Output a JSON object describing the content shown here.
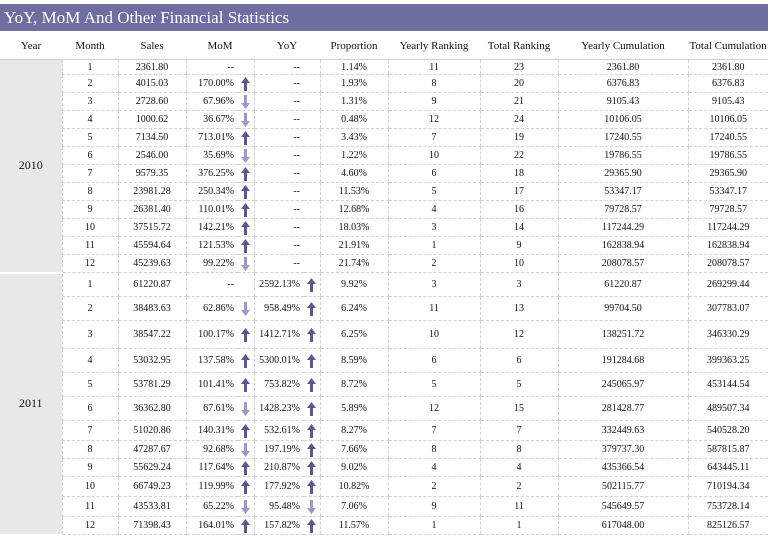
{
  "title": "YoY, MoM And Other Financial Statistics",
  "headers": [
    "Year",
    "Month",
    "Sales",
    "MoM",
    "YoY",
    "Proportion",
    "Yearly Ranking",
    "Total Ranking",
    "Yearly Cumulation",
    "Total Cumulation"
  ],
  "colors": {
    "title_bg": "#6e6fa0",
    "arrow_up": "#5a5a8a",
    "arrow_down": "#9a9ac8",
    "year_bg": "#e8e8e8"
  },
  "groups": [
    {
      "year": "2010",
      "rows": [
        {
          "month": "1",
          "sales": "2361.80",
          "mom": "--",
          "mom_dir": "",
          "yoy": "--",
          "yoy_dir": "",
          "prop": "1.14%",
          "yr": "11",
          "tr": "23",
          "ycum": "2361.80",
          "tcum": "2361.80"
        },
        {
          "month": "2",
          "sales": "4015.03",
          "mom": "170.00%",
          "mom_dir": "up",
          "yoy": "--",
          "yoy_dir": "",
          "prop": "1.93%",
          "yr": "8",
          "tr": "20",
          "ycum": "6376.83",
          "tcum": "6376.83"
        },
        {
          "month": "3",
          "sales": "2728.60",
          "mom": "67.96%",
          "mom_dir": "down",
          "yoy": "--",
          "yoy_dir": "",
          "prop": "1.31%",
          "yr": "9",
          "tr": "21",
          "ycum": "9105.43",
          "tcum": "9105.43"
        },
        {
          "month": "4",
          "sales": "1000.62",
          "mom": "36.67%",
          "mom_dir": "down",
          "yoy": "--",
          "yoy_dir": "",
          "prop": "0.48%",
          "yr": "12",
          "tr": "24",
          "ycum": "10106.05",
          "tcum": "10106.05"
        },
        {
          "month": "5",
          "sales": "7134.50",
          "mom": "713.01%",
          "mom_dir": "up",
          "yoy": "--",
          "yoy_dir": "",
          "prop": "3.43%",
          "yr": "7",
          "tr": "19",
          "ycum": "17240.55",
          "tcum": "17240.55"
        },
        {
          "month": "6",
          "sales": "2546.00",
          "mom": "35.69%",
          "mom_dir": "down",
          "yoy": "--",
          "yoy_dir": "",
          "prop": "1.22%",
          "yr": "10",
          "tr": "22",
          "ycum": "19786.55",
          "tcum": "19786.55"
        },
        {
          "month": "7",
          "sales": "9579.35",
          "mom": "376.25%",
          "mom_dir": "up",
          "yoy": "--",
          "yoy_dir": "",
          "prop": "4.60%",
          "yr": "6",
          "tr": "18",
          "ycum": "29365.90",
          "tcum": "29365.90"
        },
        {
          "month": "8",
          "sales": "23981.28",
          "mom": "250.34%",
          "mom_dir": "up",
          "yoy": "--",
          "yoy_dir": "",
          "prop": "11.53%",
          "yr": "5",
          "tr": "17",
          "ycum": "53347.17",
          "tcum": "53347.17"
        },
        {
          "month": "9",
          "sales": "26381.40",
          "mom": "110.01%",
          "mom_dir": "up",
          "yoy": "--",
          "yoy_dir": "",
          "prop": "12.68%",
          "yr": "4",
          "tr": "16",
          "ycum": "79728.57",
          "tcum": "79728.57"
        },
        {
          "month": "10",
          "sales": "37515.72",
          "mom": "142.21%",
          "mom_dir": "up",
          "yoy": "--",
          "yoy_dir": "",
          "prop": "18.03%",
          "yr": "3",
          "tr": "14",
          "ycum": "117244.29",
          "tcum": "117244.29"
        },
        {
          "month": "11",
          "sales": "45594.64",
          "mom": "121.53%",
          "mom_dir": "up",
          "yoy": "--",
          "yoy_dir": "",
          "prop": "21.91%",
          "yr": "1",
          "tr": "9",
          "ycum": "162838.94",
          "tcum": "162838.94"
        },
        {
          "month": "12",
          "sales": "45239.63",
          "mom": "99.22%",
          "mom_dir": "down",
          "yoy": "--",
          "yoy_dir": "",
          "prop": "21.74%",
          "yr": "2",
          "tr": "10",
          "ycum": "208078.57",
          "tcum": "208078.57"
        }
      ]
    },
    {
      "year": "2011",
      "rows": [
        {
          "month": "1",
          "sales": "61220.87",
          "mom": "--",
          "mom_dir": "",
          "yoy": "2592.13%",
          "yoy_dir": "up",
          "prop": "9.92%",
          "yr": "3",
          "tr": "3",
          "ycum": "61220.87",
          "tcum": "269299.44"
        },
        {
          "month": "2",
          "sales": "38483.63",
          "mom": "62.86%",
          "mom_dir": "down",
          "yoy": "958.49%",
          "yoy_dir": "up",
          "prop": "6.24%",
          "yr": "11",
          "tr": "13",
          "ycum": "99704.50",
          "tcum": "307783.07"
        },
        {
          "month": "3",
          "sales": "38547.22",
          "mom": "100.17%",
          "mom_dir": "up",
          "yoy": "1412.71%",
          "yoy_dir": "up",
          "prop": "6.25%",
          "yr": "10",
          "tr": "12",
          "ycum": "138251.72",
          "tcum": "346330.29"
        },
        {
          "month": "4",
          "sales": "53032.95",
          "mom": "137.58%",
          "mom_dir": "up",
          "yoy": "5300.01%",
          "yoy_dir": "up",
          "prop": "8.59%",
          "yr": "6",
          "tr": "6",
          "ycum": "191284.68",
          "tcum": "399363.25"
        },
        {
          "month": "5",
          "sales": "53781.29",
          "mom": "101.41%",
          "mom_dir": "up",
          "yoy": "753.82%",
          "yoy_dir": "up",
          "prop": "8.72%",
          "yr": "5",
          "tr": "5",
          "ycum": "245065.97",
          "tcum": "453144.54"
        },
        {
          "month": "6",
          "sales": "36362.80",
          "mom": "67.61%",
          "mom_dir": "down",
          "yoy": "1428.23%",
          "yoy_dir": "up",
          "prop": "5.89%",
          "yr": "12",
          "tr": "15",
          "ycum": "281428.77",
          "tcum": "489507.34"
        },
        {
          "month": "7",
          "sales": "51020.86",
          "mom": "140.31%",
          "mom_dir": "up",
          "yoy": "532.61%",
          "yoy_dir": "up",
          "prop": "8.27%",
          "yr": "7",
          "tr": "7",
          "ycum": "332449.63",
          "tcum": "540528.20"
        },
        {
          "month": "8",
          "sales": "47287.67",
          "mom": "92.68%",
          "mom_dir": "down",
          "yoy": "197.19%",
          "yoy_dir": "up",
          "prop": "7.66%",
          "yr": "8",
          "tr": "8",
          "ycum": "379737.30",
          "tcum": "587815.87"
        },
        {
          "month": "9",
          "sales": "55629.24",
          "mom": "117.64%",
          "mom_dir": "up",
          "yoy": "210.87%",
          "yoy_dir": "up",
          "prop": "9.02%",
          "yr": "4",
          "tr": "4",
          "ycum": "435366.54",
          "tcum": "643445.11"
        },
        {
          "month": "10",
          "sales": "66749.23",
          "mom": "119.99%",
          "mom_dir": "up",
          "yoy": "177.92%",
          "yoy_dir": "up",
          "prop": "10.82%",
          "yr": "2",
          "tr": "2",
          "ycum": "502115.77",
          "tcum": "710194.34"
        },
        {
          "month": "11",
          "sales": "43533.81",
          "mom": "65.22%",
          "mom_dir": "down",
          "yoy": "95.48%",
          "yoy_dir": "down",
          "prop": "7.06%",
          "yr": "9",
          "tr": "11",
          "ycum": "545649.57",
          "tcum": "753728.14"
        },
        {
          "month": "12",
          "sales": "71398.43",
          "mom": "164.01%",
          "mom_dir": "up",
          "yoy": "157.82%",
          "yoy_dir": "up",
          "prop": "11.57%",
          "yr": "1",
          "tr": "1",
          "ycum": "617048.00",
          "tcum": "825126.57"
        }
      ]
    }
  ]
}
